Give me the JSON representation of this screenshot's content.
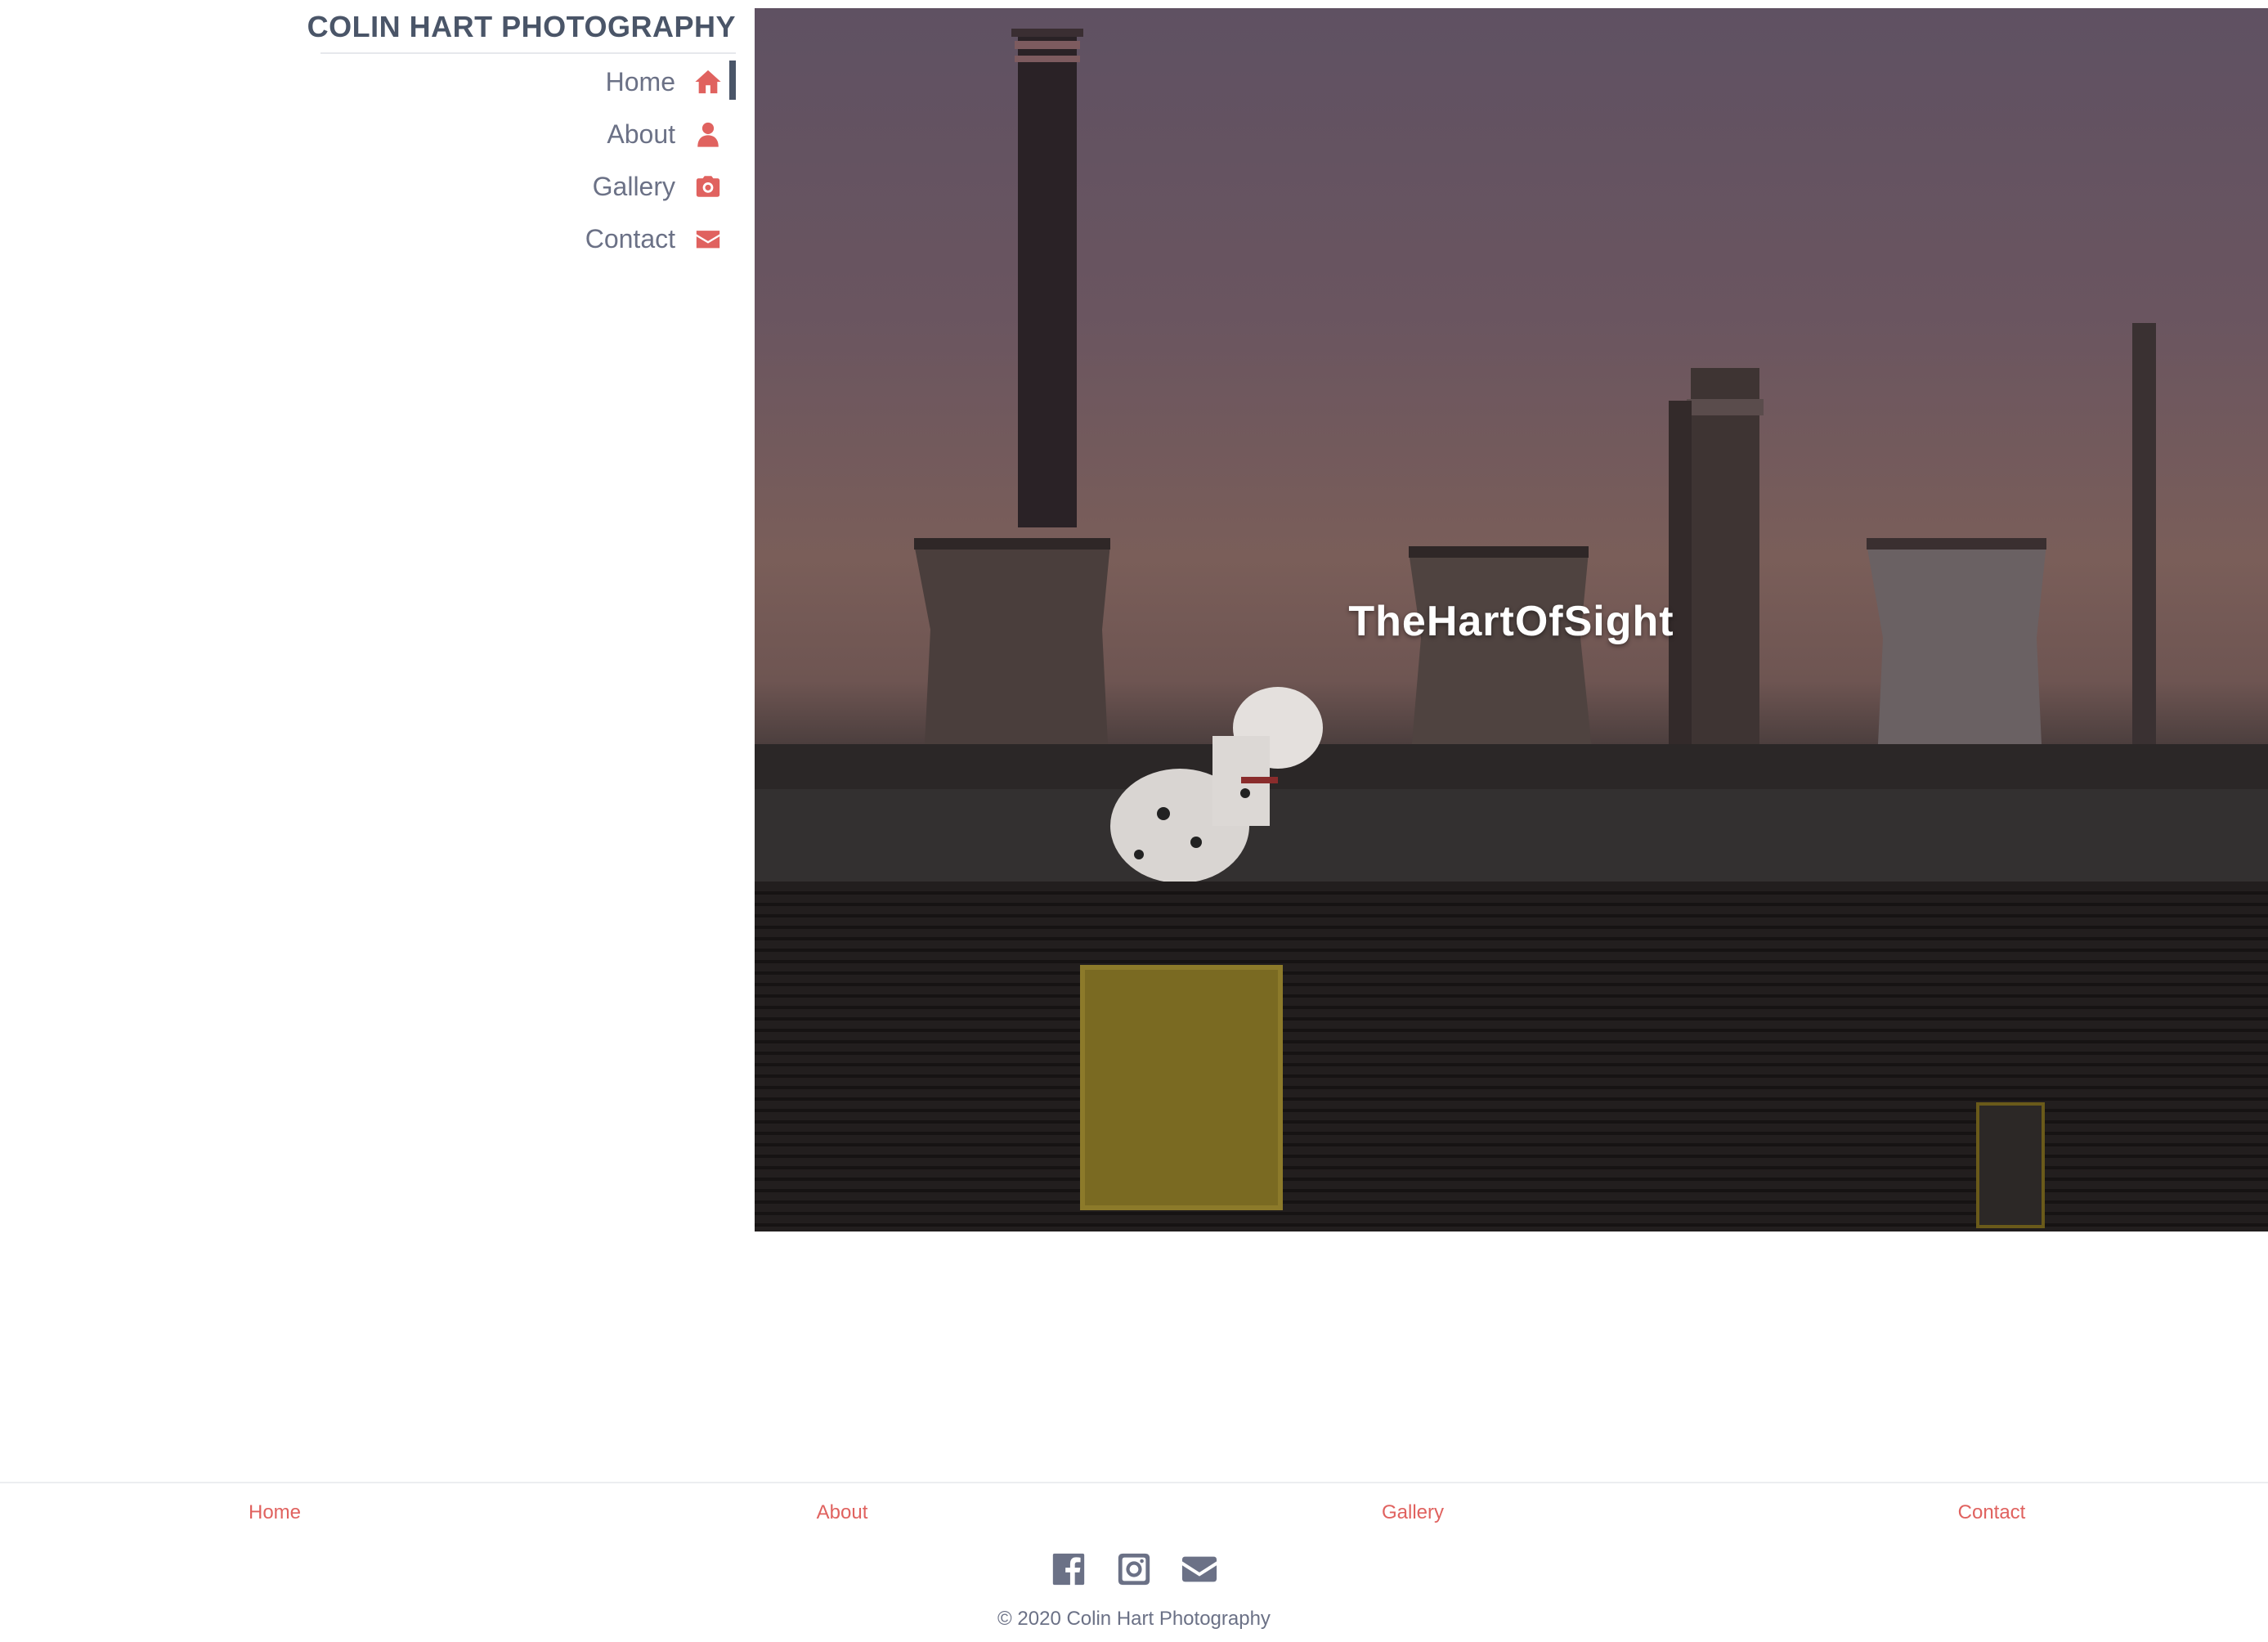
{
  "brand": {
    "title": "COLIN HART PHOTOGRAPHY"
  },
  "nav": {
    "items": [
      {
        "label": "Home",
        "icon": "home-icon",
        "active": true
      },
      {
        "label": "About",
        "icon": "user-icon",
        "active": false
      },
      {
        "label": "Gallery",
        "icon": "camera-icon",
        "active": false
      },
      {
        "label": "Contact",
        "icon": "envelope-icon",
        "active": false
      }
    ]
  },
  "hero": {
    "title": "TheHartOfSight"
  },
  "footer": {
    "links": [
      "Home",
      "About",
      "Gallery",
      "Contact"
    ],
    "social": [
      "facebook-icon",
      "instagram-icon",
      "email-icon"
    ],
    "copyright": "© 2020 Colin Hart Photography"
  },
  "colors": {
    "accent": "#e0625f",
    "text": "#6b7186",
    "brand_text": "#4a5568",
    "active_bar": "#4a5568"
  }
}
